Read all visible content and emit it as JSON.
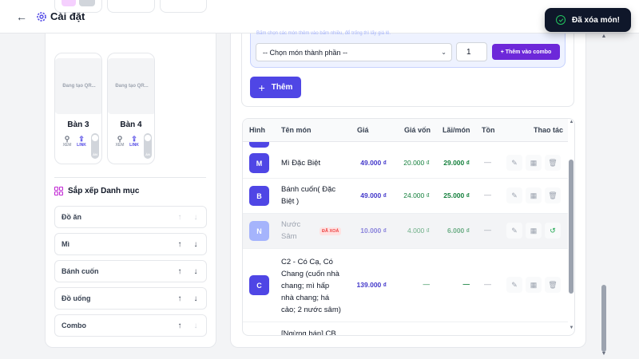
{
  "header": {
    "title": "Cài đặt"
  },
  "toast": {
    "message": "Đã xóa món!"
  },
  "tables": {
    "cards": [
      {
        "name": "Bàn 3",
        "qr_text": "Đang tạo QR...",
        "view_label": "XEM",
        "link_label": "LINK",
        "toggle_label": "ẨN"
      },
      {
        "name": "Bàn 4",
        "qr_text": "Đang tạo QR...",
        "view_label": "XEM",
        "link_label": "LINK",
        "toggle_label": "ẨN"
      }
    ]
  },
  "categories": {
    "title": "Sắp xếp Danh mục",
    "items": [
      {
        "label": "Đồ ăn"
      },
      {
        "label": "Mì"
      },
      {
        "label": "Bánh cuốn"
      },
      {
        "label": "Đồ uống"
      },
      {
        "label": "Combo"
      }
    ]
  },
  "combo_form": {
    "hint": "Bấm chọn các món thêm vào bấm nhiều, để trống thì lấy giá lẻ.",
    "select_value": "-- Chọn món thành phần --",
    "quantity": "1",
    "add_combo_label": "+ Thêm vào combo",
    "add_label": "Thêm"
  },
  "menu_table": {
    "headers": {
      "image": "Hình",
      "name": "Tên món",
      "price": "Giá",
      "cost": "Giá vốn",
      "profit": "Lãi/món",
      "stock": "Tồn",
      "actions": "Thao tác"
    },
    "rows": [
      {
        "initial": "M",
        "name": "Mì Đặc Biệt",
        "price": "49.000 ₫",
        "cost": "20.000 ₫",
        "profit": "29.000 ₫",
        "stock": "—",
        "deleted": false
      },
      {
        "initial": "B",
        "name1": "Bánh cuốn( Đặc",
        "name2": "Biệt )",
        "price": "49.000 ₫",
        "cost": "24.000 ₫",
        "profit": "25.000 ₫",
        "stock": "—",
        "deleted": false
      },
      {
        "initial": "N",
        "name1": "Nước",
        "name2": "Sâm",
        "badge": "ĐÃ XOÁ",
        "price": "10.000 ₫",
        "cost": "4.000 ₫",
        "profit": "6.000 ₫",
        "stock": "—",
        "deleted": true
      },
      {
        "initial": "C",
        "lines": [
          "C2 - Có Cạ, Có",
          "Chang (cuốn nhà",
          "chang; mì hấp",
          "nhà chang; há",
          "cảo; 2 nước sâm)"
        ],
        "price": "139.000 ₫",
        "cost": "—",
        "profit": "—",
        "stock": "—",
        "deleted": false
      },
      {
        "partial_name": "[Ngừng bán] CB"
      }
    ]
  },
  "colors": {
    "primary": "#4f46e5",
    "purple": "#6d28d9",
    "green": "#15803d",
    "danger": "#ef4444",
    "toast_bg": "#0f172a"
  }
}
